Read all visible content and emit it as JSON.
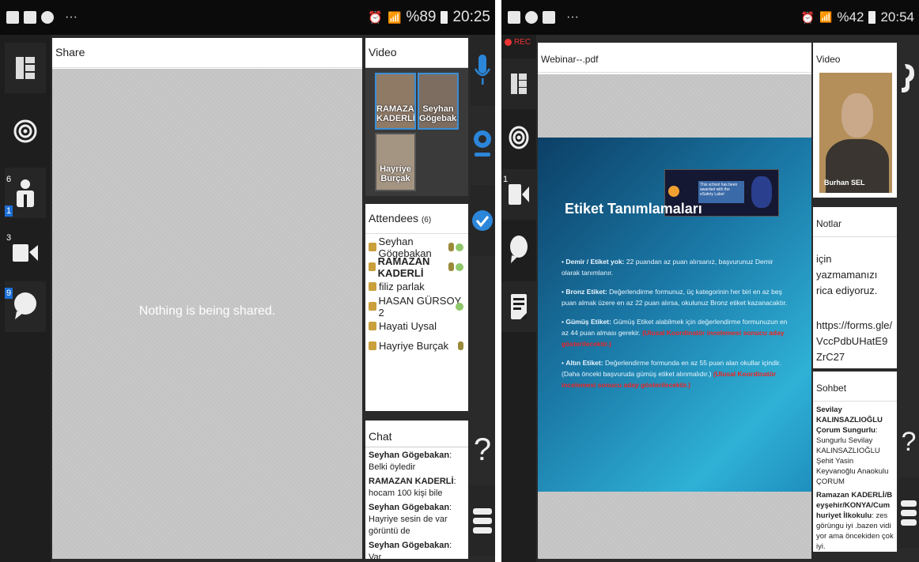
{
  "left": {
    "status": {
      "battery": "%89",
      "time": "20:25",
      "dots": "···"
    },
    "sidebar": {
      "participants_count": "6",
      "participants_badge": "1",
      "video_count": "3",
      "chat_badge": "9"
    },
    "share": {
      "title": "Share",
      "empty_text": "Nothing is being shared."
    },
    "video": {
      "title": "Video",
      "tiles": [
        {
          "name": "RAMAZAN KADERLİ"
        },
        {
          "name": "Seyhan Gögebakan"
        },
        {
          "name": "Hayriye Burçak"
        }
      ]
    },
    "attendees": {
      "title": "Attendees",
      "count": "(6)",
      "items": [
        {
          "name": "Seyhan Gögebakan",
          "bold": false
        },
        {
          "name": "RAMAZAN KADERLİ",
          "bold": true
        },
        {
          "name": "filiz parlak",
          "bold": false
        },
        {
          "name": "HASAN GÜRSOY 2",
          "bold": false
        },
        {
          "name": "Hayati Uysal",
          "bold": false
        },
        {
          "name": "Hayriye Burçak",
          "bold": false
        }
      ]
    },
    "chat": {
      "title": "Chat",
      "messages": [
        {
          "sender": "Seyhan Gögebakan",
          "text": ": Belki öyledir"
        },
        {
          "sender": "RAMAZAN KADERLİ",
          "text": ": hocam 100 kişi bile"
        },
        {
          "sender": "Seyhan Gögebakan",
          "text": ": Hayriye sesin de var görüntü de"
        },
        {
          "sender": "Seyhan Gögebakan",
          "text": ": Var"
        }
      ]
    },
    "help_label": "?"
  },
  "right": {
    "status": {
      "battery": "%42",
      "time": "20:54",
      "dots": "···",
      "rec": "REC"
    },
    "sidebar": {
      "video_count": "1"
    },
    "document": {
      "title": "Webinar--.pdf"
    },
    "slide": {
      "title": "Etiket Tanımlamaları",
      "banner_text": "This school has been awarded with the eSafety Label",
      "bullets": [
        {
          "label": "Demir / Etiket yok:",
          "text": " 22 puandan az puan alırsanız, başvurunuz Demir olarak tanımlanır.",
          "red": ""
        },
        {
          "label": "Bronz Etiket:",
          "text": " Değerlendirme formunuz, üç kategorinin her biri en az beş puan almak üzere en az 22 puan alırsa, okulunuz Bronz etiket kazanacaktır.",
          "red": ""
        },
        {
          "label": "Gümüş Etiket:",
          "text": " Gümüş Etiket alabilmek için değerlendirme formunuzun en az 44 puan alması gerekir. ",
          "red": "(Ulusal Koordinatör incelemesi sonucu aday gösterilecektir.)"
        },
        {
          "label": "Altın Etiket:",
          "text": " Değerlendirme formunda en az 55 puan alan okullar içindir. (Daha önceki başvuruda gümüş etiket alınmalıdır.) ",
          "red": "(Ulusal Koordinatör incelemesi sonucu aday gösterilecektir.)"
        }
      ]
    },
    "video": {
      "title": "Video",
      "tile_name": "Burhan SEL"
    },
    "notes": {
      "title": "Notlar",
      "lines": [
        "için yazmamanızı rica ediyoruz.",
        "https://forms.gle/VccPdbUHatE9ZrC27"
      ]
    },
    "sohbet": {
      "title": "Sohbet",
      "messages": [
        {
          "sender": "Sevilay KALINSAZLIOĞLU Çorum Sungurlu",
          "text": ": Sungurlu Sevilay KALINSAZLIOĞLU Şehit Yasin Keyvanoğlu Anaokulu ÇORUM"
        },
        {
          "sender": "Ramazan KADERLİ/Beyşehir/KONYA/Cumhuriyet İlkokulu",
          "text": ": zes görüngu iyi .bazen vidiyor ama öncekiden çok iyi."
        }
      ]
    },
    "help_label": "?"
  }
}
